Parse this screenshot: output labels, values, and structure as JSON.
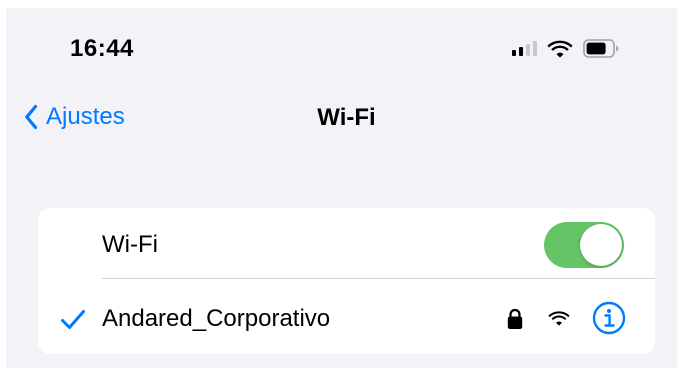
{
  "status_bar": {
    "time": "16:44",
    "signal_icon": "cellular-signal-icon",
    "wifi_icon": "wifi-icon",
    "battery_icon": "battery-icon"
  },
  "nav": {
    "back_label": "Ajustes",
    "back_icon": "chevron-left-icon",
    "title": "Wi-Fi"
  },
  "wifi_section": {
    "toggle_label": "Wi-Fi",
    "toggle_on": true,
    "network": {
      "name": "Andared_Corporativo",
      "selected": true,
      "secured": true,
      "icons": [
        "checkmark-icon",
        "lock-icon",
        "wifi-signal-icon",
        "info-icon"
      ]
    }
  },
  "colors": {
    "accent": "#007aff",
    "toggle_on": "#65c466",
    "background": "#f2f2f7",
    "card": "#ffffff",
    "separator": "#d1d1d6"
  }
}
